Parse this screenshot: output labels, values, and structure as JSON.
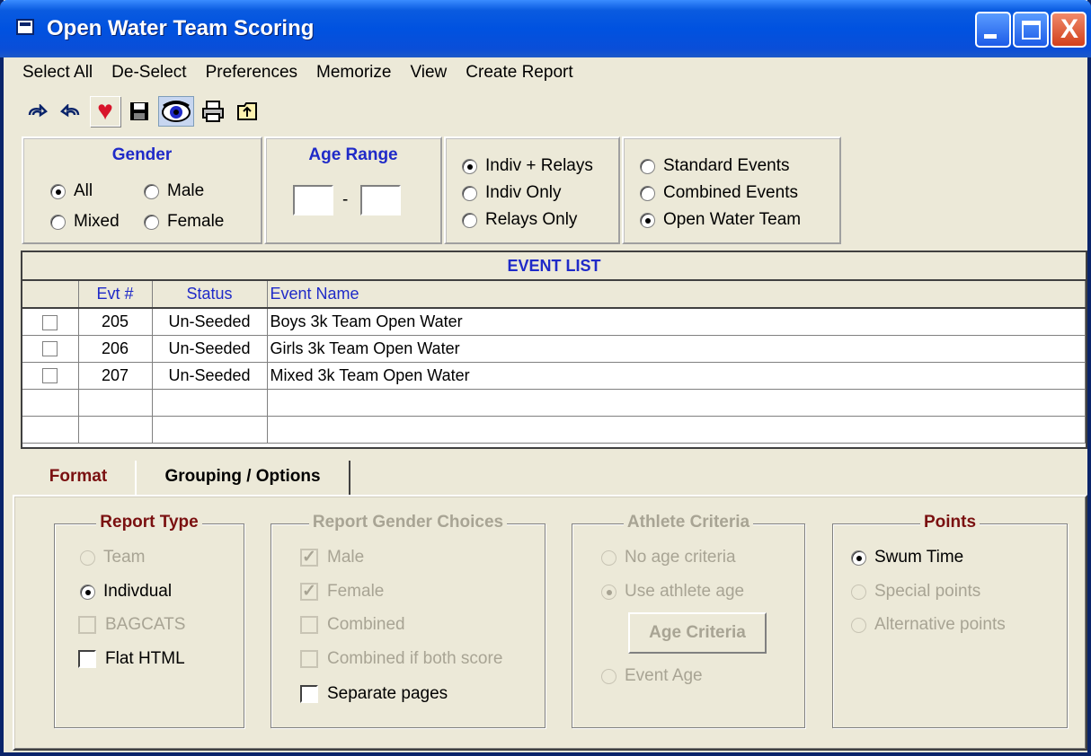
{
  "window": {
    "title": "Open Water Team Scoring"
  },
  "titlebar_buttons": {
    "close_glyph": "X"
  },
  "menu": [
    "Select All",
    "De-Select",
    "Preferences",
    "Memorize",
    "View",
    "Create Report"
  ],
  "toolbar": {
    "icons": [
      "redo-icon",
      "undo-icon",
      "heart-icon",
      "save-icon",
      "eye-icon",
      "print-icon",
      "export-icon"
    ],
    "heart_color": "#d8142a"
  },
  "gender": {
    "title": "Gender",
    "options": [
      {
        "label": "All",
        "selected": true
      },
      {
        "label": "Male",
        "selected": false
      },
      {
        "label": "Mixed",
        "selected": false
      },
      {
        "label": "Female",
        "selected": false
      }
    ]
  },
  "age_range": {
    "title": "Age Range",
    "separator": "-",
    "from": "",
    "to": ""
  },
  "event_kind": {
    "options": [
      {
        "label": "Indiv + Relays",
        "selected": true
      },
      {
        "label": "Indiv Only",
        "selected": false
      },
      {
        "label": "Relays Only",
        "selected": false
      }
    ]
  },
  "event_type": {
    "options": [
      {
        "label": "Standard Events",
        "selected": false
      },
      {
        "label": "Combined Events",
        "selected": false
      },
      {
        "label": "Open Water Team",
        "selected": true
      }
    ]
  },
  "event_list": {
    "title": "EVENT LIST",
    "columns": [
      "Evt #",
      "Status",
      "Event Name"
    ],
    "rows": [
      {
        "evt": "205",
        "status": "Un-Seeded",
        "name": "Boys 3k Team Open Water"
      },
      {
        "evt": "206",
        "status": "Un-Seeded",
        "name": "Girls 3k Team Open Water"
      },
      {
        "evt": "207",
        "status": "Un-Seeded",
        "name": "Mixed 3k Team Open Water"
      }
    ]
  },
  "tabs": [
    "Format",
    "Grouping / Options"
  ],
  "report_type": {
    "title": "Report Type",
    "team": "Team",
    "individual": "Indivdual",
    "bagcats": "BAGCATS",
    "flat_html": "Flat HTML"
  },
  "report_gender": {
    "title": "Report Gender Choices",
    "male": "Male",
    "female": "Female",
    "combined": "Combined",
    "combined_both": "Combined if both score",
    "separate_pages": "Separate pages"
  },
  "athlete_criteria": {
    "title": "Athlete Criteria",
    "no_age": "No age criteria",
    "use_age": "Use athlete age",
    "age_button": "Age Criteria",
    "event_age": "Event Age"
  },
  "points": {
    "title": "Points",
    "swum": "Swum Time",
    "special": "Special points",
    "alternative": "Alternative points"
  },
  "colors": {
    "title_blue": "#1f2ac8",
    "active_tab": "#7a1010",
    "disabled": "#a8a494"
  }
}
